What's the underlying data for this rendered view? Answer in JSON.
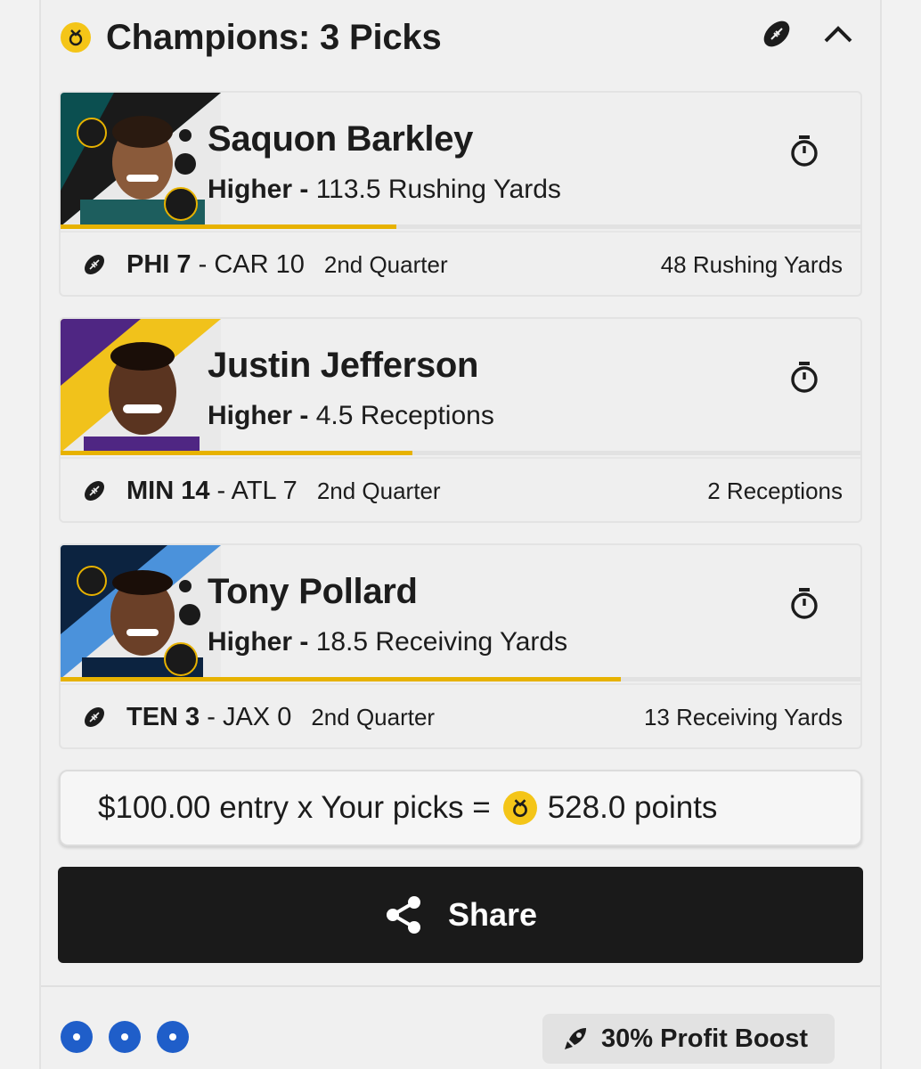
{
  "header": {
    "title": "Champions: 3 Picks",
    "medal_icon": "medal-icon",
    "sport_icon": "football-icon",
    "collapse_icon": "chevron-up-icon"
  },
  "picks": [
    {
      "name": "Saquon Barkley",
      "direction": "Higher",
      "separator": " - ",
      "line": "113.5 Rushing Yards",
      "progress": 0.42,
      "team_home": "PHI 7",
      "score_sep": " - ",
      "team_away": "CAR 10",
      "quarter": "2nd Quarter",
      "current_stat": "48 Rushing Yards",
      "team_colors": [
        "#0b4f50",
        "#1a1a1a"
      ]
    },
    {
      "name": "Justin Jefferson",
      "direction": "Higher",
      "separator": " - ",
      "line": "4.5 Receptions",
      "progress": 0.44,
      "team_home": "MIN 14",
      "score_sep": " - ",
      "team_away": "ATL 7",
      "quarter": "2nd Quarter",
      "current_stat": "2 Receptions",
      "team_colors": [
        "#4f2683",
        "#f1c21b"
      ]
    },
    {
      "name": "Tony Pollard",
      "direction": "Higher",
      "separator": " - ",
      "line": "18.5 Receiving Yards",
      "progress": 0.7,
      "team_home": "TEN 3",
      "score_sep": " - ",
      "team_away": "JAX 0",
      "quarter": "2nd Quarter",
      "current_stat": "13 Receiving Yards",
      "team_colors": [
        "#0c2340",
        "#4b92db"
      ]
    }
  ],
  "payout": {
    "prefix": "$100.00 entry x Your picks =",
    "points": "528.0 points"
  },
  "share": {
    "label": "Share",
    "icon": "share-icon"
  },
  "footer": {
    "dots_count": 3,
    "boost_label": "30% Profit Boost",
    "boost_icon": "rocket-icon"
  },
  "colors": {
    "accent_gold": "#f4c518",
    "progress": "#e7b200",
    "dark": "#1a1a1a",
    "dot_blue": "#1f5ec9"
  }
}
